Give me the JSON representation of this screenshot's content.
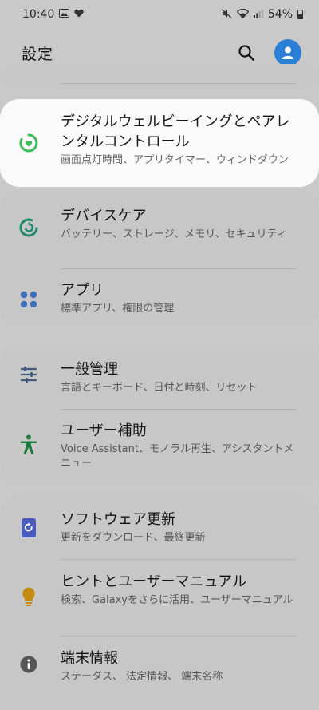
{
  "status_bar": {
    "time": "10:40",
    "battery": "54%"
  },
  "header": {
    "title": "設定"
  },
  "items": {
    "digital_wellbeing": {
      "title": "デジタルウェルビーイングとペアレンタルコントロール",
      "subtitle": "画面点灯時間、アプリタイマー、ウィンドダウン",
      "icon": "digital-wellbeing-icon",
      "icon_color": "#3dbb55"
    },
    "device_care": {
      "title": "デバイスケア",
      "subtitle": "バッテリー、ストレージ、メモリ、セキュリティ",
      "icon": "device-care-icon",
      "icon_color": "#1f8a6a"
    },
    "apps": {
      "title": "アプリ",
      "subtitle": "標準アプリ、権限の管理",
      "icon": "apps-icon",
      "icon_color": "#3f6fb8"
    },
    "general_management": {
      "title": "一般管理",
      "subtitle": "言語とキーボード、日付と時刻、リセット",
      "icon": "sliders-icon",
      "icon_color": "#445a7a"
    },
    "accessibility": {
      "title": "ユーザー補助",
      "subtitle": "Voice Assistant、モノラル再生、アシスタントメニュー",
      "icon": "accessibility-icon",
      "icon_color": "#1c7a3a"
    },
    "software_update": {
      "title": "ソフトウェア更新",
      "subtitle": "更新をダウンロード、最終更新",
      "icon": "software-update-icon",
      "icon_color": "#4a5bc0"
    },
    "tips": {
      "title": "ヒントとユーザーマニュアル",
      "subtitle": "検索、Galaxyをさらに活用、ユーザーマニュアル",
      "icon": "lightbulb-icon",
      "icon_color": "#c58a12"
    },
    "about_phone": {
      "title": "端末情報",
      "subtitle": "ステータス、 法定情報、 端末名称",
      "icon": "info-icon",
      "icon_color": "#555555"
    }
  }
}
